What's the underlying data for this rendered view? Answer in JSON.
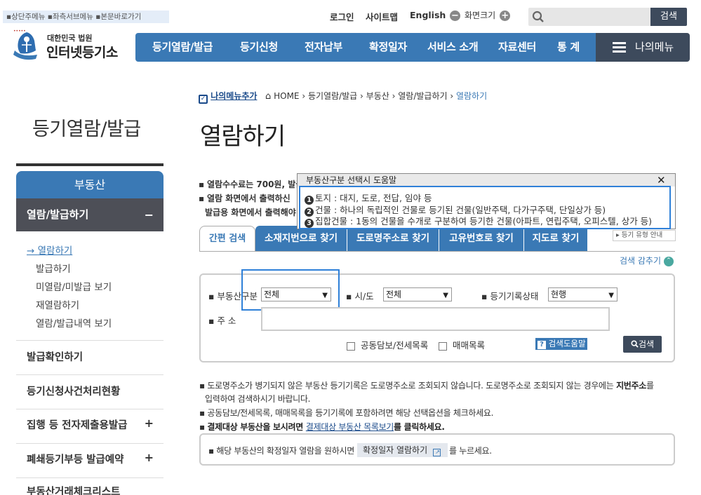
{
  "skip_links": [
    "상단주메뉴",
    "좌측서브메뉴",
    "본문바로가기"
  ],
  "utility": {
    "login": "로그인",
    "sitemap": "사이트맵",
    "english": "English",
    "zoom_label": "화면크기",
    "zoom_out": "−",
    "zoom_in": "+"
  },
  "search": {
    "button": "검색",
    "placeholder": ""
  },
  "logo": {
    "sub": "대한민국 법원",
    "main": "인터넷등기소"
  },
  "gnb": [
    "등기열람/발급",
    "등기신청",
    "전자납부",
    "확정일자",
    "서비스 소개",
    "자료센터",
    "통 계"
  ],
  "my_menu": "나의메뉴",
  "lnb": {
    "title": "등기열람/발급",
    "head": "부동산",
    "active": "열람/발급하기",
    "active_toggle": "−",
    "sub_items": [
      "열람하기",
      "발급하기",
      "미열람/미발급 보기",
      "재열람하기",
      "열람/발급내역 보기"
    ],
    "menus": [
      {
        "label": "발급확인하기",
        "toggle": ""
      },
      {
        "label": "등기신청사건처리현황",
        "toggle": ""
      },
      {
        "label": "집행 등 전자제출용발급",
        "toggle": "+"
      },
      {
        "label": "폐쇄등기부등 발급예약",
        "toggle": "+"
      },
      {
        "label": "부동산거래체크리스트",
        "toggle": ""
      }
    ]
  },
  "breadcrumb": {
    "add_menu": "나의메뉴추가",
    "items": [
      "HOME",
      "등기열람/발급",
      "부동산",
      "열람/발급하기",
      "열람하기"
    ]
  },
  "page_title": "열람하기",
  "notices": [
    "열람수수료는 700원, 발급",
    "열람 화면에서 출력하신",
    "발급용 화면에서 출력해야"
  ],
  "popup": {
    "title": "부동산구분 선택시 도움말",
    "close": "✕",
    "lines": [
      {
        "num": "1",
        "text": "토지 : 대지, 도로, 전답, 임야 등"
      },
      {
        "num": "2",
        "text": "건물 : 하나의 독립적인 건물로 등기된 건물(일반주택, 다가구주택, 단일상가 등)"
      },
      {
        "num": "3",
        "text": "집합건물 : 1동의 건물을 수개로 구분하여 등기한 건물(아파트, 연립주택, 오피스텔, 상가 등)"
      }
    ]
  },
  "tabs": {
    "active": "간편 검색",
    "items": [
      "소재지번으로 찾기",
      "도로명주소로 찾기",
      "고유번호로 찾기",
      "지도로 찾기"
    ]
  },
  "type_guide": "등기 유형 안내",
  "collapse_search": "검색 감추기",
  "form": {
    "property_type_label": "부동산구분",
    "property_type_value": "전체",
    "sido_label": "시/도",
    "sido_value": "전체",
    "record_status_label": "등기기록상태",
    "record_status_value": "현행",
    "address_label": "주 소",
    "address_value": "",
    "check1": "공동담보/전세목록",
    "check2": "매매목록",
    "help_button": "검색도움말",
    "search_button": "검색"
  },
  "bottom_notes": {
    "n1a": "도로명주소가 병기되지 않은 부동산 등기기록은 도로명주소로 조회되지 않습니다. 도로명주소로 조회되지 않는 경우에는 ",
    "n1b": "지번주소",
    "n1c": "를",
    "n1d": "입력하여 검색하시기 바랍니다.",
    "n2": "공동담보/전세목록, 매매목록을 등기기록에 포함하려면 해당 선택옵션을 체크하세요.",
    "n3a": "결제대상 부동산을 보시려면 ",
    "n3b": "결제대상 부동산 목록보기",
    "n3c": "를 클릭하세요.",
    "box_text_a": "해당 부동산의 확정일자 열람을 원하시면",
    "box_button": "확정일자 열람하기",
    "box_text_b": "를 누르세요."
  },
  "colors": {
    "primary": "#3a79b5",
    "dark": "#3d4a5c",
    "highlight": "#2f80d8",
    "active_menu": "#4d4f57"
  }
}
